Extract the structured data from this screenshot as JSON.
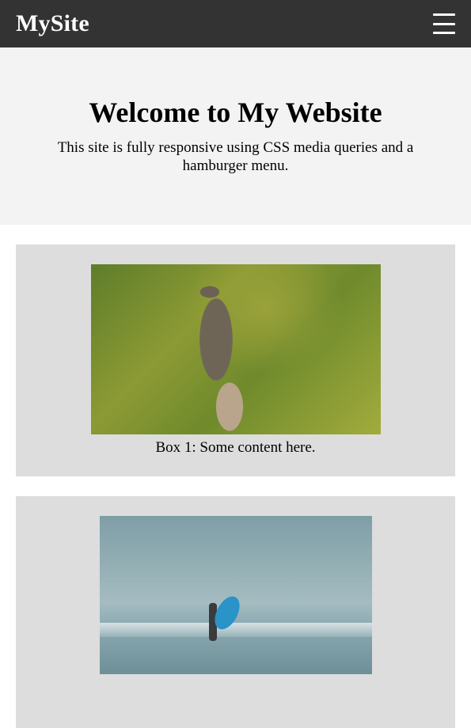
{
  "header": {
    "logo": "MySite",
    "menu_icon": "hamburger-menu-icon"
  },
  "hero": {
    "title": "Welcome to My Website",
    "subtitle": "This site is fully responsive using CSS media queries and a hamburger menu."
  },
  "boxes": [
    {
      "image": "owl-photo",
      "caption": "Box 1: Some content here."
    },
    {
      "image": "beach-surfer-photo"
    }
  ]
}
